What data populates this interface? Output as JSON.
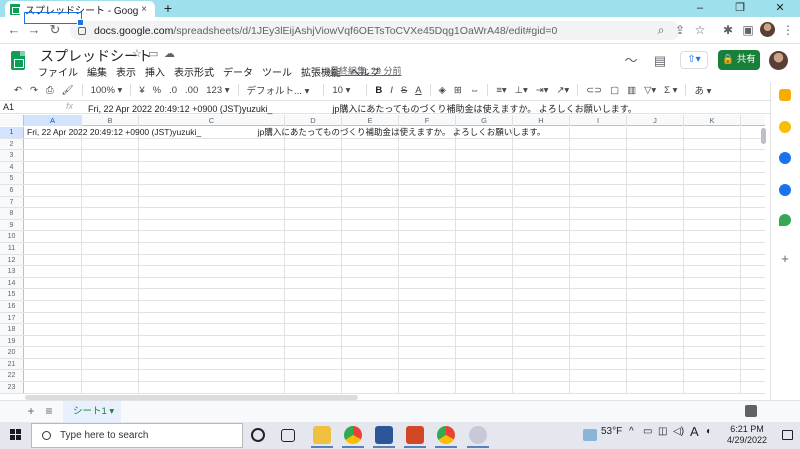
{
  "browser": {
    "tab_title": "スプレッドシート - Google スプレッド",
    "tab_close": "×",
    "new_tab": "+",
    "win_minimize": "–",
    "win_maximize": "❐",
    "win_close": "✕",
    "url_host": "docs.google.com",
    "url_path": "/spreadsheets/d/1JEy3lEijAshjViowVqf6OETsToCVXe45Dqg1OaWrA48/edit#gid=0"
  },
  "sheets": {
    "title": "スプレッドシート",
    "menu": [
      "ファイル",
      "編集",
      "表示",
      "挿入",
      "表示形式",
      "データ",
      "ツール",
      "拡張機能",
      "ヘルプ"
    ],
    "last_edit": "最終編集: 29 分前",
    "share_label": "共有",
    "toolbar": {
      "zoom": "100%",
      "currency": "¥",
      "percent": "%",
      "dec_less": ".0",
      "dec_more": ".00",
      "more_formats": "123",
      "font": "デフォルト...",
      "font_size": "10",
      "bold": "B",
      "italic": "I",
      "strike": "S",
      "text_color": "A",
      "sigma": "Σ",
      "input_tools": "あ"
    },
    "namebox": "A1",
    "fx": "fx",
    "formula_content": "Fri, 22 Apr 2022 20:49:12 +0900 (JST)yuzuki_                        jp購入にあたってものづくり補助金は使えますか。 よろしくお願いします。",
    "columns": [
      "A",
      "B",
      "C",
      "D",
      "E",
      "F",
      "G",
      "H",
      "I",
      "J",
      "K"
    ],
    "rows": [
      "1",
      "2",
      "3",
      "4",
      "5",
      "6",
      "7",
      "8",
      "9",
      "10",
      "11",
      "12",
      "13",
      "14",
      "15",
      "16",
      "17",
      "18",
      "19",
      "20",
      "21",
      "22",
      "23"
    ],
    "row1_content": "Fri, 22 Apr 2022 20:49:12 +0900 (JST)yuzuki_                        jp購入にあたってものづくり補助金は使えますか。 よろしくお願いします。",
    "add_sheet": "+",
    "all_sheets": "≡",
    "sheet_tab": "シート1 ▾"
  },
  "taskbar": {
    "search_placeholder": "Type here to search",
    "weather": "53°F",
    "ime": "A",
    "time": "6:21 PM",
    "date": "4/29/2022"
  }
}
